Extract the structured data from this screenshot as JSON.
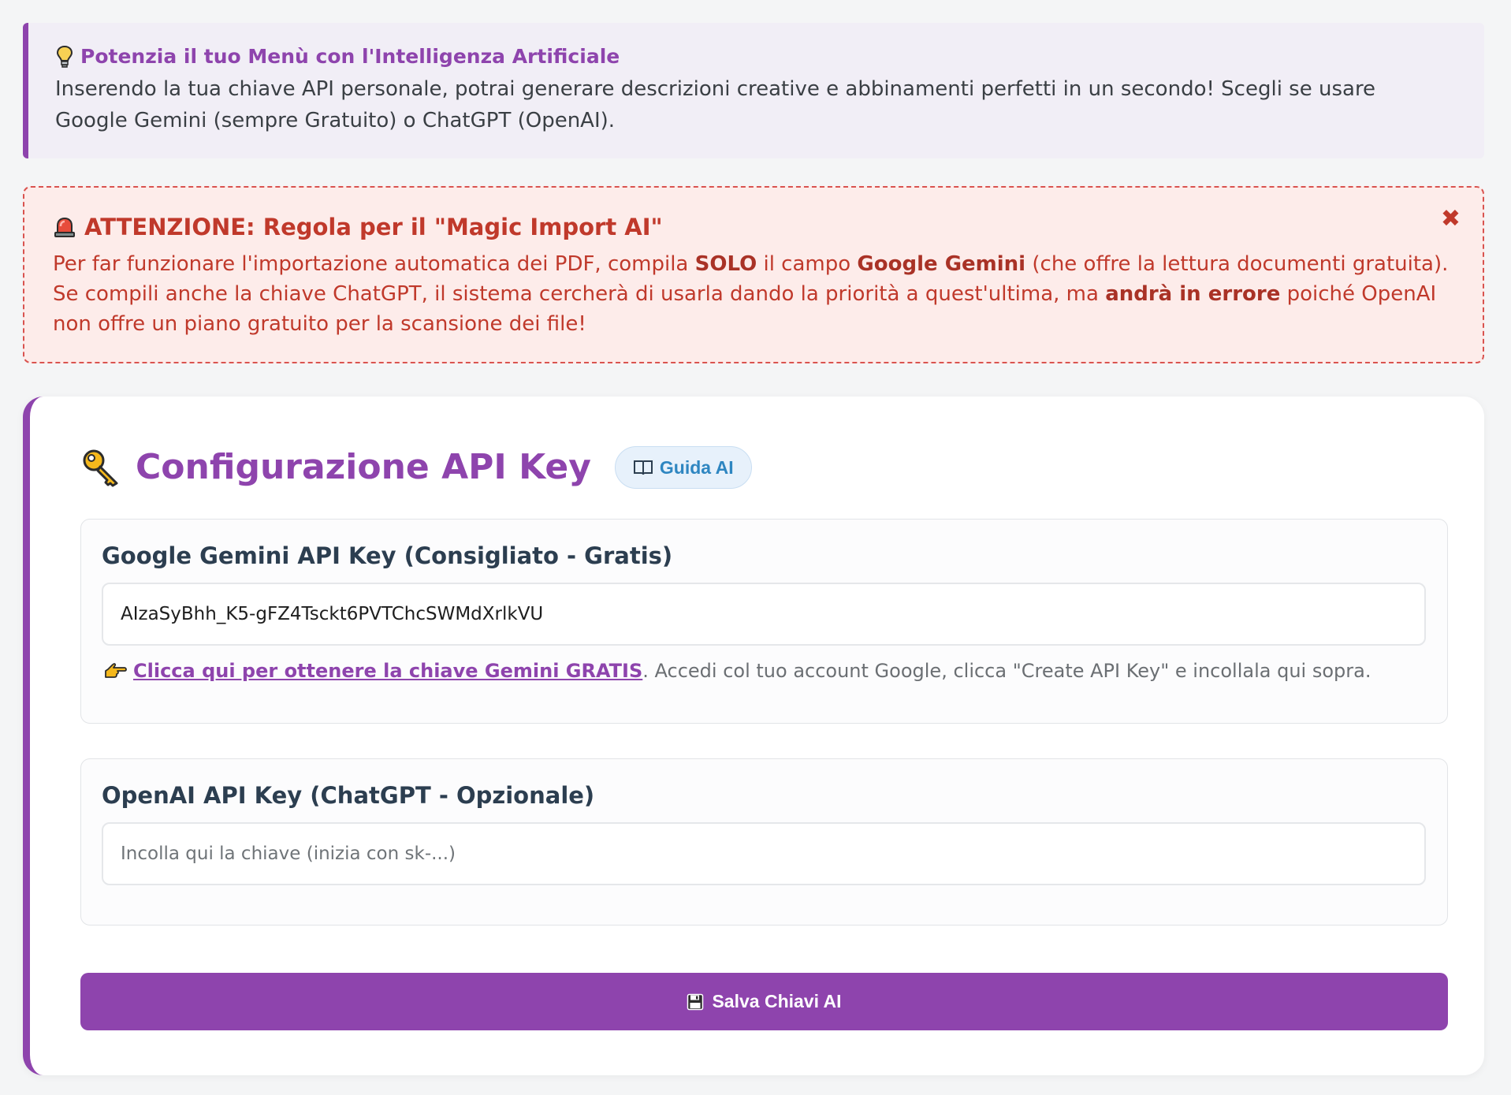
{
  "info": {
    "title": "Potenzia il tuo Menù con l'Intelligenza Artificiale",
    "text": "Inserendo la tua chiave API personale, potrai generare descrizioni creative e abbinamenti perfetti in un secondo! Scegli se usare Google Gemini (sempre Gratuito) o ChatGPT (OpenAI).",
    "icon": "lightbulb-icon"
  },
  "warning": {
    "title": "ATTENZIONE: Regola per il \"Magic Import AI\"",
    "icon": "siren-icon",
    "close": "✖",
    "line1_a": "Per far funzionare l'importazione automatica dei PDF, compila ",
    "line1_b": "SOLO",
    "line1_c": " il campo ",
    "line1_d": "Google Gemini",
    "line1_e": " (che offre la lettura documenti gratuita).",
    "line2_a": "Se compili anche la chiave ChatGPT, il sistema cercherà di usarla dando la priorità a quest'ultima, ma ",
    "line2_b": "andrà in errore",
    "line2_c": " poiché OpenAI non offre un piano gratuito per la scansione dei file!"
  },
  "config": {
    "title": "Configurazione API Key",
    "guide_button": "Guida AI",
    "gemini": {
      "label": "Google Gemini API Key (Consigliato - Gratis)",
      "value": "AIzaSyBhh_K5-gFZ4Tsckt6PVTChcSWMdXrlkVU",
      "help_link": "Clicca qui per ottenere la chiave Gemini GRATIS",
      "help_text": ". Accedi col tuo account Google, clicca \"Create API Key\" e incollala qui sopra."
    },
    "openai": {
      "label": "OpenAI API Key (ChatGPT - Opzionale)",
      "value": "",
      "placeholder": "Incolla qui la chiave (inizia con sk-...)"
    },
    "save_button": "Salva Chiavi AI"
  },
  "colors": {
    "accent": "#8e44ad",
    "warning": "#c0392b",
    "info_bg": "#f1eef6",
    "warning_bg": "#fdecea",
    "guide": "#2e86c1"
  }
}
